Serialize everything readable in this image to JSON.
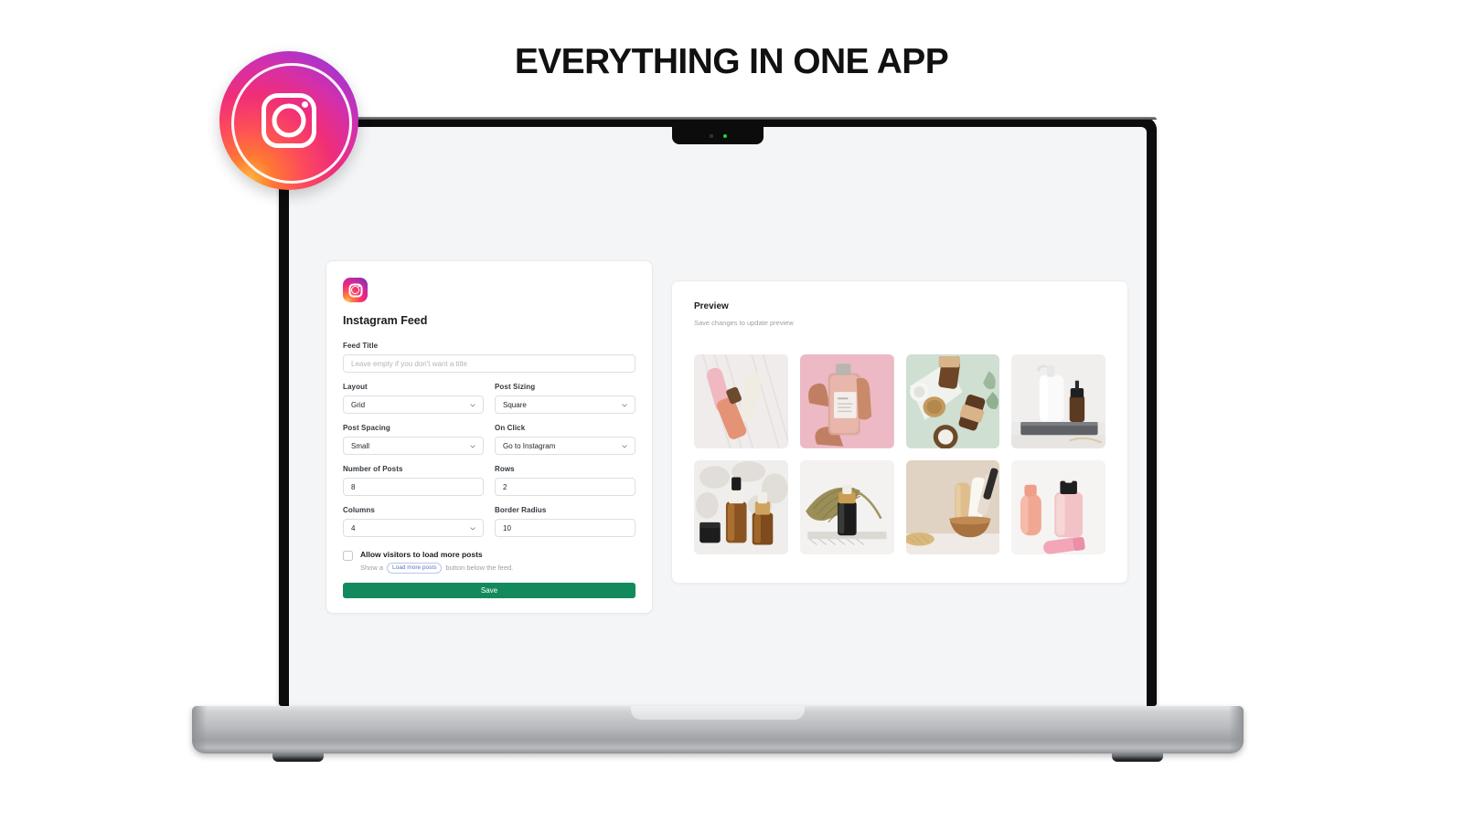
{
  "headline": "EVERYTHING IN ONE APP",
  "brand_badge": {
    "icon": "instagram-logo-icon",
    "alt": "Instagram"
  },
  "device": {
    "type": "laptop",
    "camera_icon": "camera-dot-icon",
    "status_led": "green-indicator-led"
  },
  "app": {
    "icon": "instagram-app-icon",
    "title": "Instagram Feed",
    "fields": {
      "feed_title": {
        "label": "Feed Title",
        "value": "",
        "placeholder": "Leave empty if you don't want a title"
      },
      "layout": {
        "label": "Layout",
        "value": "Grid",
        "type": "select"
      },
      "post_sizing": {
        "label": "Post Sizing",
        "value": "Square",
        "type": "select"
      },
      "post_spacing": {
        "label": "Post Spacing",
        "value": "Small",
        "type": "select"
      },
      "on_click": {
        "label": "On Click",
        "value": "Go to Instagram",
        "type": "select"
      },
      "number_of_posts": {
        "label": "Number of Posts",
        "value": "8",
        "type": "text"
      },
      "rows": {
        "label": "Rows",
        "value": "2",
        "type": "text"
      },
      "columns": {
        "label": "Columns",
        "value": "4",
        "type": "select"
      },
      "border_radius": {
        "label": "Border Radius",
        "value": "10",
        "type": "text"
      }
    },
    "load_more": {
      "checked": false,
      "title": "Allow visitors to load more posts",
      "hint_before": "Show a",
      "pill_label": "Load more posts",
      "hint_after": "button below the feed."
    },
    "save_label": "Save",
    "save_color": "#138a5e"
  },
  "preview": {
    "title": "Preview",
    "subtitle": "Save changes to update preview",
    "tiles": [
      {
        "name": "pink-tubes-and-serum-bottle-on-white-fabric"
      },
      {
        "name": "hand-holding-labeled-pink-bottle-on-pink-background"
      },
      {
        "name": "amber-dropper-bottles-flat-lay-on-mint-green"
      },
      {
        "name": "white-pump-bottle-and-amber-dropper-on-stone-slab"
      },
      {
        "name": "amber-dropper-bottles-with-black-jar-shadow-light"
      },
      {
        "name": "black-dropper-bottle-with-dried-palm-leaf"
      },
      {
        "name": "cream-bottles-in-wooden-bowl-with-brush"
      },
      {
        "name": "pink-tube-and-rose-serum-bottle-on-white"
      }
    ]
  }
}
